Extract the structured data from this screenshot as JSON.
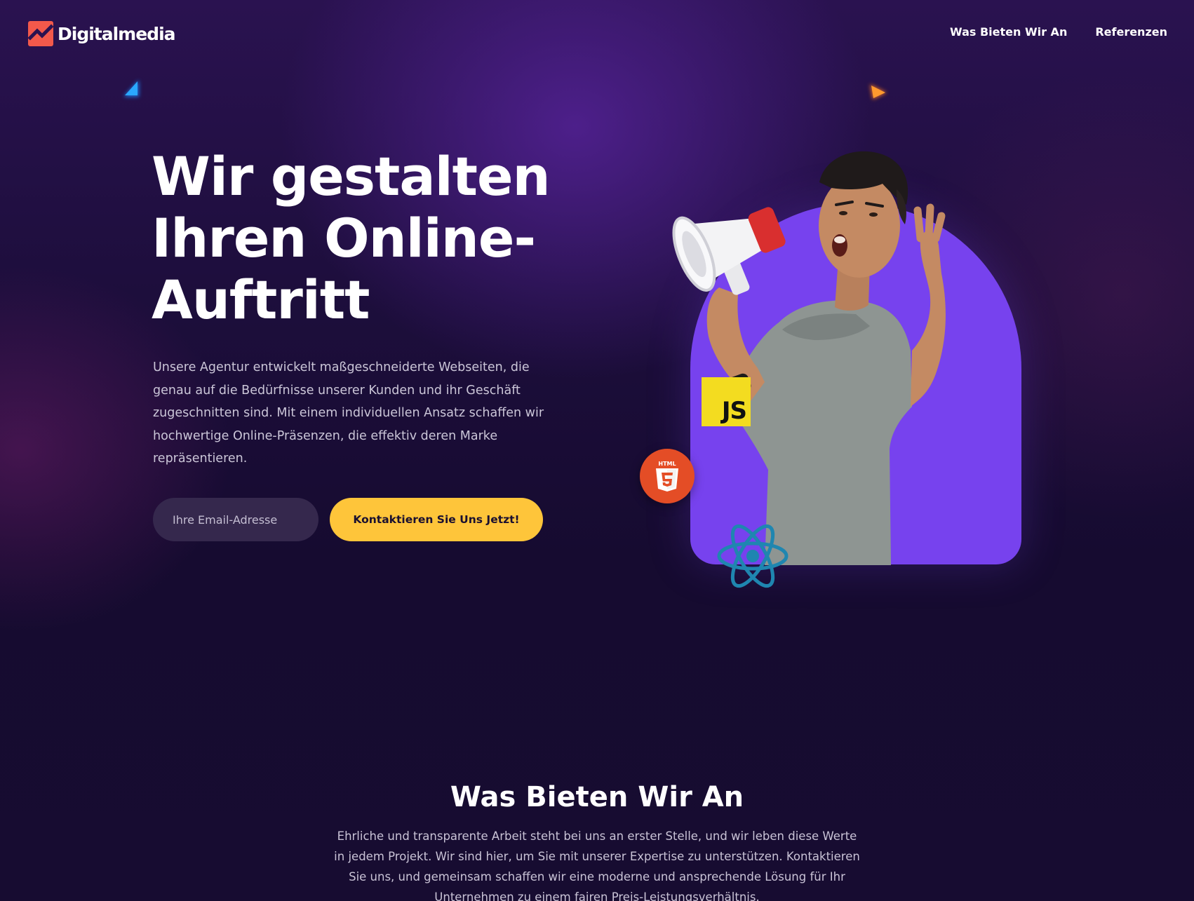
{
  "brand": {
    "name": "Digitalmedia",
    "accent": "#f2594b"
  },
  "nav": {
    "links": [
      "Was Bieten Wir An",
      "Referenzen"
    ]
  },
  "hero": {
    "title_lines": [
      "Wir gestalten",
      "Ihren Online-",
      "Auftritt"
    ],
    "description": "Unsere Agentur entwickelt maßgeschneiderte Webseiten, die genau auf die Bedürfnisse unserer Kunden und ihr Geschäft zugeschnitten sind. Mit einem individuellen Ansatz schaffen wir hochwertige Online-Präsenzen, die effektiv deren Marke repräsentieren.",
    "email_placeholder": "Ihre Email-Adresse",
    "cta_label": "Kontaktieren Sie Uns Jetzt!",
    "badges": {
      "js": "JS",
      "html5": "HTML"
    }
  },
  "section": {
    "title": "Was Bieten Wir An",
    "text": "Ehrliche und transparente Arbeit steht bei uns an erster Stelle, und wir leben diese Werte in jedem Projekt. Wir sind hier, um Sie mit unserer Expertise zu unterstützen. Kontaktieren Sie uns, und gemeinsam schaffen wir eine moderne und ansprechende Lösung für Ihr Unternehmen zu einem fairen Preis-Leistungsverhältnis."
  },
  "colors": {
    "background": "#160b30",
    "cta": "#fec53a",
    "arch": "#7742ee",
    "input_bg": "#35284d"
  },
  "icons": [
    "logo-icon",
    "blue-triangle-icon",
    "orange-triangle-icon",
    "js-icon",
    "html5-icon",
    "react-icon",
    "megaphone-icon"
  ]
}
